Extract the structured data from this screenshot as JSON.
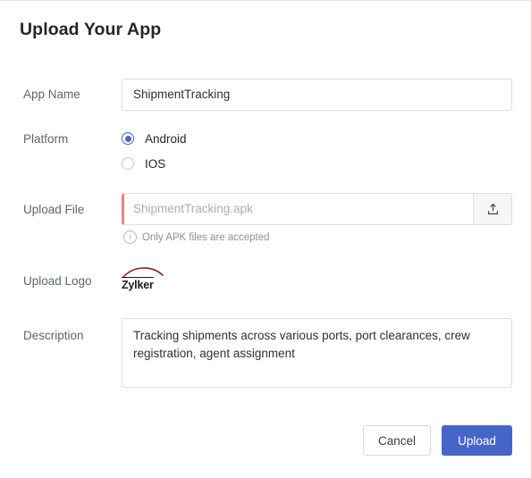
{
  "header": {
    "title": "Upload Your App"
  },
  "form": {
    "app_name": {
      "label": "App Name",
      "value": "ShipmentTracking",
      "placeholder": ""
    },
    "platform": {
      "label": "Platform",
      "options": [
        {
          "label": "Android",
          "selected": true
        },
        {
          "label": "IOS",
          "selected": false
        }
      ]
    },
    "upload_file": {
      "label": "Upload File",
      "placeholder": "ShipmentTracking.apk",
      "value": "",
      "hint": "Only APK files are accepted",
      "hint_icon": "info-circle-icon",
      "upload_icon": "upload-tray-icon",
      "error_accent_color": "#f08080"
    },
    "upload_logo": {
      "label": "Upload Logo",
      "logo_text": "Zylker",
      "logo_arc_color": "#8f1f1f"
    },
    "description": {
      "label": "Description",
      "value": "Tracking shipments across various ports, port clearances, crew registration, agent assignment",
      "placeholder": ""
    }
  },
  "actions": {
    "cancel_label": "Cancel",
    "upload_label": "Upload",
    "primary_color": "#4566c8"
  }
}
